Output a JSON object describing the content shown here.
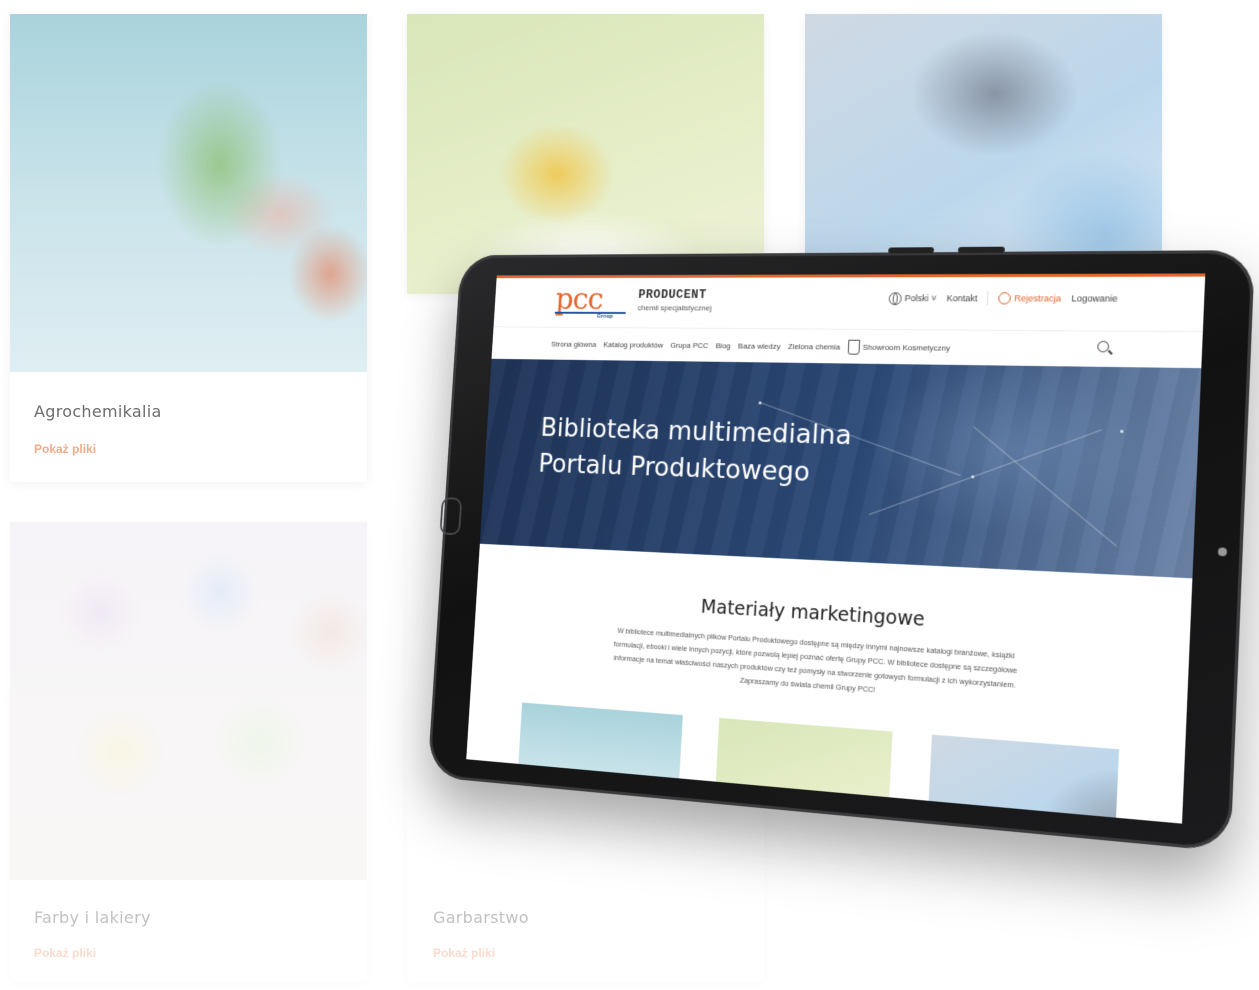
{
  "background_cards": [
    {
      "title": "Agrochemikalia",
      "link": "Pokaż pliki"
    },
    {
      "title": "Farby i lakiery",
      "link": "Pokaż pliki"
    },
    {
      "title": "Garbarstwo",
      "link": "Pokaż pliki"
    }
  ],
  "site": {
    "logo": "pcc",
    "logo_group": "Group",
    "brand_title": "PRODUCENT",
    "brand_subtitle": "chemii specjalistycznej",
    "language": "Polski",
    "contact": "Kontakt",
    "register": "Rejestracja",
    "login": "Logowanie",
    "nav": [
      "Strona główna",
      "Katalog produktów",
      "Grupa PCC",
      "Blog",
      "Baza wiedzy",
      "Zielona chemia",
      "Showroom Kosmetyczny"
    ],
    "hero_title_line1": "Biblioteka multimedialna",
    "hero_title_line2": "Portalu Produktowego",
    "section_title": "Materiały marketingowe",
    "section_text": "W bibliotece multimedialnych plików Portalu Produktowego dostępne są między innymi najnowsze katalogi branżowe, książki formulacji, ebooki i wiele innych pozycji, które pozwolą lepiej poznać ofertę Grupy PCC. W bibliotece dostępne są szczegółowe informacje na temat właściwości naszych produktów czy też pomysły na stworzenie gotowych formulacji z ich wykorzystaniem. Zapraszamy do świata chemii Grupy PCC!"
  },
  "colors": {
    "accent": "#e2672f",
    "brand_blue": "#244f9e",
    "hero_dark": "#1e3357"
  },
  "icons": [
    "globe-icon",
    "user-circle-icon",
    "flask-icon",
    "search-icon"
  ]
}
